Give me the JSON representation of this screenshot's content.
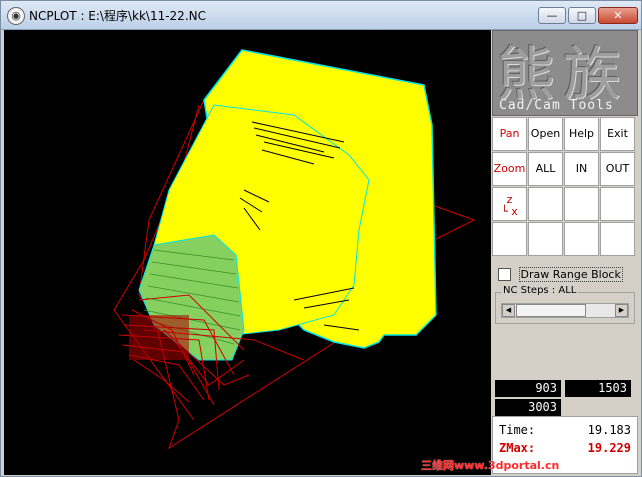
{
  "window": {
    "app_icon": "pig-icon",
    "title": "NCPLOT : E:\\程序\\kk\\11-22.NC",
    "min_label": "—",
    "max_label": "□",
    "close_label": "✕"
  },
  "logo": {
    "cjk": "熊族",
    "subtitle": "Cad/Cam Tools"
  },
  "toolbar": {
    "pan": "Pan",
    "open": "Open",
    "help": "Help",
    "exit": "Exit",
    "zoom": "Zoom",
    "all": "ALL",
    "in": "IN",
    "out": "OUT",
    "axis_icon": "xyz-axis-icon"
  },
  "options": {
    "draw_range_block": "Draw Range Block",
    "draw_range_block_checked": false,
    "nc_steps_label": "NC Steps : ALL",
    "nc_steps_fraction": 0.7
  },
  "counters": {
    "a": "903",
    "b": "1503",
    "c": "3003"
  },
  "info": {
    "time_label": "Time:",
    "time_value": "19.183",
    "zmax_label": "ZMax:",
    "zmax_value": "19.229"
  },
  "watermark": "三维网www.3dportal.cn",
  "colors": {
    "background": "#000000",
    "part": "#ffff00",
    "edge": "#00e5e5",
    "toolpath": "#d00000",
    "mesh": "#7fdc5a"
  }
}
